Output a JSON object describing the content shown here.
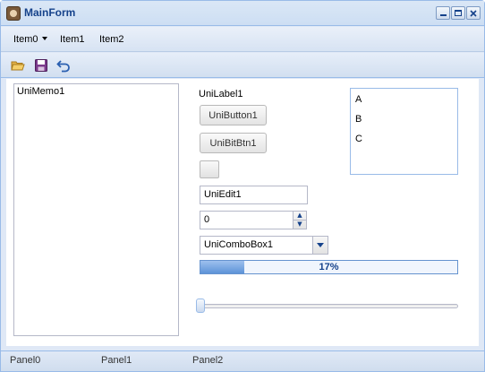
{
  "window": {
    "title": "MainForm",
    "controls": [
      "minimize-icon",
      "maximize-icon",
      "close-icon"
    ],
    "accent_color": "#15428b",
    "border_color": "#99bbe8"
  },
  "menu": {
    "items": [
      {
        "label": "Item0",
        "has_dropdown": true
      },
      {
        "label": "Item1",
        "has_dropdown": false
      },
      {
        "label": "Item2",
        "has_dropdown": false
      }
    ]
  },
  "toolbar": {
    "icons": [
      "open-folder-icon",
      "save-icon",
      "undo-icon"
    ]
  },
  "memo": {
    "text": "UniMemo1"
  },
  "label": {
    "text": "UniLabel1"
  },
  "button": {
    "label": "UniButton1"
  },
  "bitbtn": {
    "label": "UniBitBtn1"
  },
  "edit": {
    "value": "UniEdit1"
  },
  "spin": {
    "value": "0"
  },
  "combo": {
    "value": "UniComboBox1"
  },
  "progress": {
    "value": 17,
    "text": "17%",
    "fill_color": "#5d93d8"
  },
  "slider": {
    "value": 0
  },
  "listbox": {
    "items": [
      "A",
      "B",
      "C"
    ]
  },
  "statusbar": {
    "panels": [
      "Panel0",
      "Panel1",
      "Panel2"
    ]
  }
}
